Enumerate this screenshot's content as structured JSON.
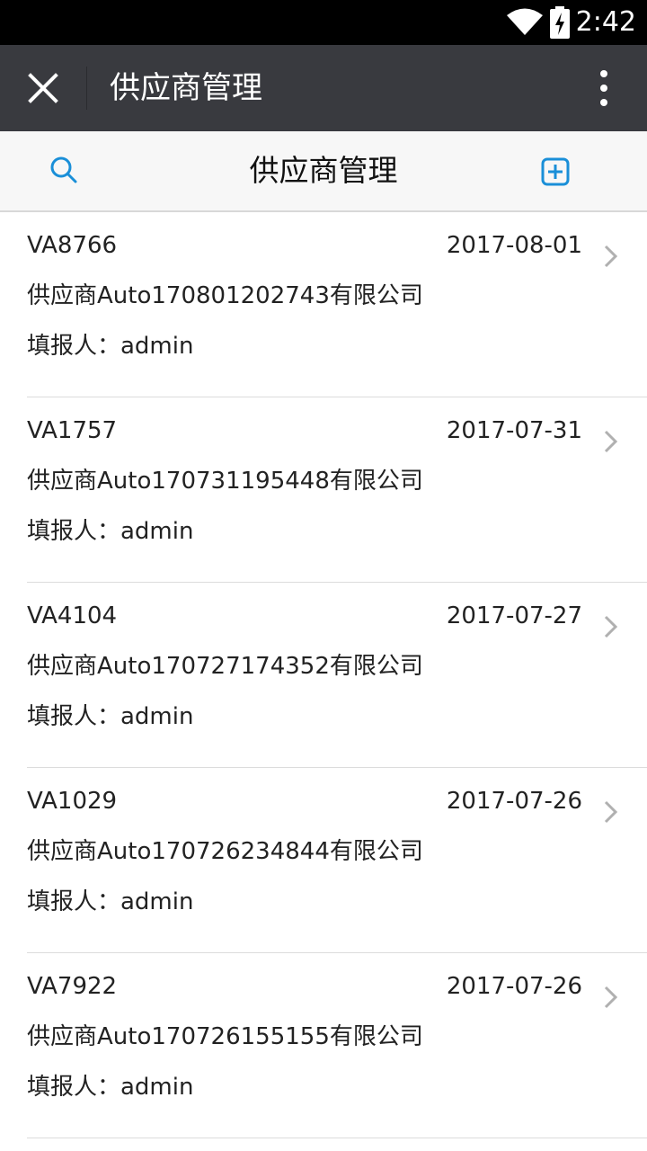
{
  "status_bar": {
    "time": "2:42",
    "icons": [
      "wifi-icon",
      "battery-charging-icon"
    ]
  },
  "app_bar": {
    "title": "供应商管理",
    "icons": [
      "close-icon",
      "more-vertical-icon"
    ]
  },
  "toolbar": {
    "title": "供应商管理",
    "icons": [
      "search-icon",
      "add-square-icon"
    ],
    "accent_color": "#1a8fd8"
  },
  "list": {
    "items": [
      {
        "code": "VA8766",
        "date": "2017-08-01",
        "name": "供应商Auto170801202743有限公司",
        "reporter": "填报人：admin"
      },
      {
        "code": "VA1757",
        "date": "2017-07-31",
        "name": "供应商Auto170731195448有限公司",
        "reporter": "填报人：admin"
      },
      {
        "code": "VA4104",
        "date": "2017-07-27",
        "name": "供应商Auto170727174352有限公司",
        "reporter": "填报人：admin"
      },
      {
        "code": "VA1029",
        "date": "2017-07-26",
        "name": "供应商Auto170726234844有限公司",
        "reporter": "填报人：admin"
      },
      {
        "code": "VA7922",
        "date": "2017-07-26",
        "name": "供应商Auto170726155155有限公司",
        "reporter": "填报人：admin"
      }
    ]
  },
  "colors": {
    "status_bar_bg": "#000000",
    "app_bar_bg": "#393a3f",
    "toolbar_bg": "#f7f7f7",
    "divider": "#dcdcdc"
  }
}
